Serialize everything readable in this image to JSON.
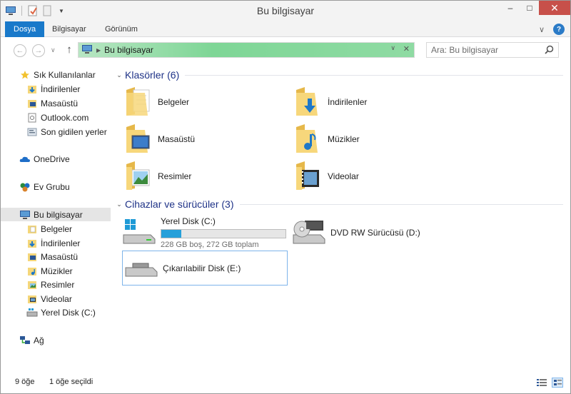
{
  "window": {
    "title": "Bu bilgisayar",
    "controls": {
      "minimize": "–",
      "maximize": "□",
      "close": "✕"
    }
  },
  "ribbon": {
    "tabs": [
      {
        "label": "Dosya",
        "active": true
      },
      {
        "label": "Bilgisayar",
        "active": false
      },
      {
        "label": "Görünüm",
        "active": false
      }
    ]
  },
  "address": {
    "path": [
      "Bu bilgisayar"
    ],
    "search_placeholder": "Ara: Bu bilgisayar"
  },
  "nav": {
    "items": [
      {
        "label": "Sık Kullanılanlar",
        "icon": "star-icon",
        "level": 0
      },
      {
        "label": "İndirilenler",
        "icon": "downloads-folder-icon",
        "level": 1
      },
      {
        "label": "Masaüstü",
        "icon": "desktop-folder-icon",
        "level": 1
      },
      {
        "label": "Outlook.com",
        "icon": "outlook-icon",
        "level": 1
      },
      {
        "label": "Son gidilen yerler",
        "icon": "recent-places-icon",
        "level": 1
      },
      {
        "label": "OneDrive",
        "icon": "onedrive-icon",
        "level": 0
      },
      {
        "label": "Ev Grubu",
        "icon": "homegroup-icon",
        "level": 0
      },
      {
        "label": "Bu bilgisayar",
        "icon": "computer-icon",
        "level": 0,
        "selected": true
      },
      {
        "label": "Belgeler",
        "icon": "documents-folder-icon",
        "level": 1
      },
      {
        "label": "İndirilenler",
        "icon": "downloads-folder-icon",
        "level": 1
      },
      {
        "label": "Masaüstü",
        "icon": "desktop-folder-icon",
        "level": 1
      },
      {
        "label": "Müzikler",
        "icon": "music-folder-icon",
        "level": 1
      },
      {
        "label": "Resimler",
        "icon": "pictures-folder-icon",
        "level": 1
      },
      {
        "label": "Videolar",
        "icon": "videos-folder-icon",
        "level": 1
      },
      {
        "label": "Yerel Disk (C:)",
        "icon": "drive-icon",
        "level": 1
      },
      {
        "label": "Ağ",
        "icon": "network-icon",
        "level": 0
      }
    ]
  },
  "content": {
    "folders_group": "Klasörler (6)",
    "folders": [
      {
        "label": "Belgeler",
        "icon": "documents-folder-icon"
      },
      {
        "label": "İndirilenler",
        "icon": "downloads-folder-icon"
      },
      {
        "label": "Masaüstü",
        "icon": "desktop-folder-icon"
      },
      {
        "label": "Müzikler",
        "icon": "music-folder-icon"
      },
      {
        "label": "Resimler",
        "icon": "pictures-folder-icon"
      },
      {
        "label": "Videolar",
        "icon": "videos-folder-icon"
      }
    ],
    "devices_group": "Cihazlar ve sürücüler (3)",
    "devices": [
      {
        "label": "Yerel Disk (C:)",
        "icon": "hard-drive-icon",
        "free": "228 GB boş, 272 GB toplam",
        "used_fraction": 0.16
      },
      {
        "label": "DVD RW Sürücüsü (D:)",
        "icon": "dvd-drive-icon"
      },
      {
        "label": "Çıkarılabilir Disk (E:)",
        "icon": "removable-disk-icon",
        "selected": true
      }
    ]
  },
  "status": {
    "item_count": "9 öğe",
    "selected_count": "1 öğe seçildi"
  },
  "colors": {
    "accent": "#1979ca",
    "group_title": "#1e3287",
    "address_bar": "#7ed696",
    "close_button": "#c7504a",
    "capacity_bar": "#26a0da"
  }
}
